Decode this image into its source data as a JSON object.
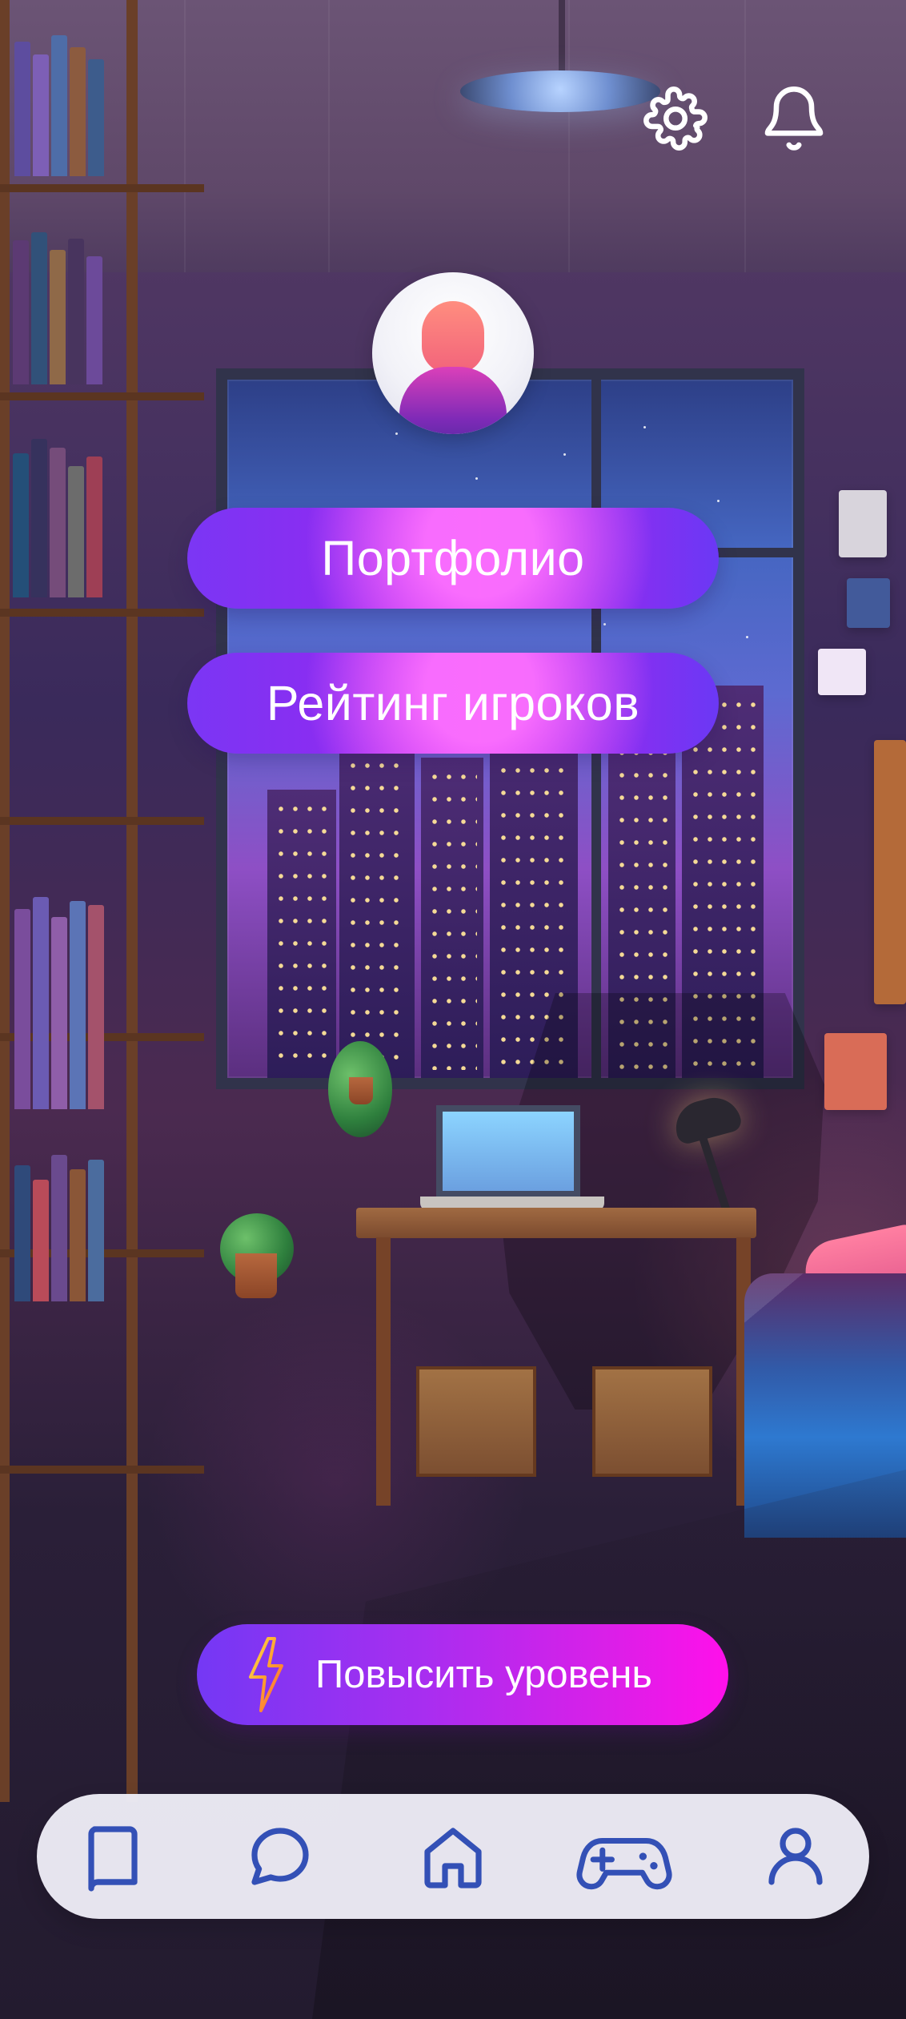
{
  "topbar": {
    "icons": [
      "gear-icon",
      "bell-icon"
    ]
  },
  "profile": {
    "avatar_icon": "user-avatar-icon",
    "buttons": {
      "portfolio": "Портфолио",
      "player_ranking": "Рейтинг игроков"
    }
  },
  "upgrade": {
    "label": "Повысить уровень",
    "icon": "lightning-bolt-icon"
  },
  "bottom_nav": {
    "items": [
      {
        "icon": "book-icon"
      },
      {
        "icon": "chat-bubble-icon"
      },
      {
        "icon": "home-icon"
      },
      {
        "icon": "gamepad-icon"
      },
      {
        "icon": "profile-icon"
      }
    ]
  },
  "colors": {
    "button_gradient_start": "#7b36f4",
    "button_gradient_end": "#ff10ea",
    "nav_background": "#eceBF5",
    "nav_icon": "#3350b6"
  }
}
